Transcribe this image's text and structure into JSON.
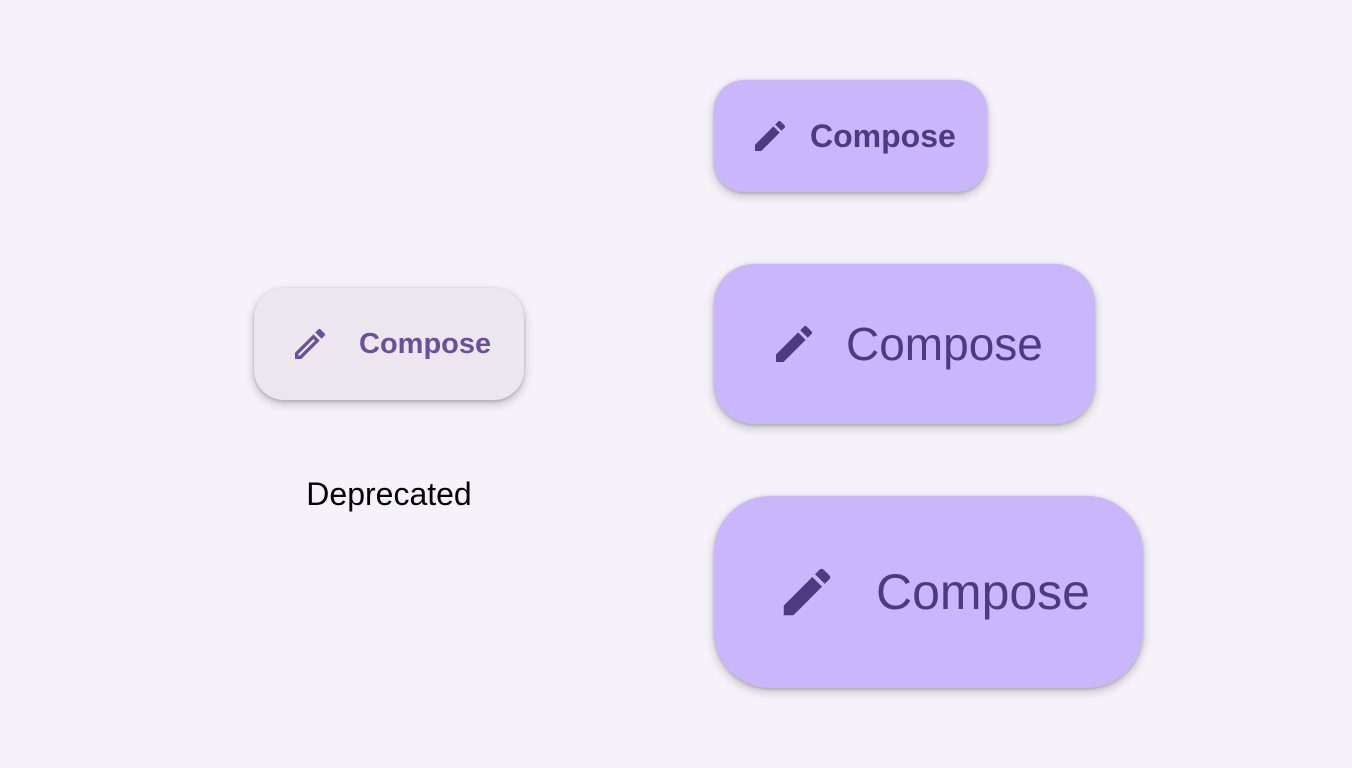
{
  "fabs": {
    "deprecated": {
      "label": "Compose",
      "icon": "edit-pencil-outline-icon"
    },
    "small": {
      "label": "Compose",
      "icon": "edit-pencil-icon"
    },
    "medium": {
      "label": "Compose",
      "icon": "edit-pencil-icon"
    },
    "large": {
      "label": "Compose",
      "icon": "edit-pencil-icon"
    }
  },
  "caption": "Deprecated",
  "colors": {
    "background": "#F6F2F9",
    "deprecated_container": "#ECE6EE",
    "deprecated_content": "#6A4F9E",
    "container": "#C9B6FB",
    "content": "#4E3A82"
  }
}
